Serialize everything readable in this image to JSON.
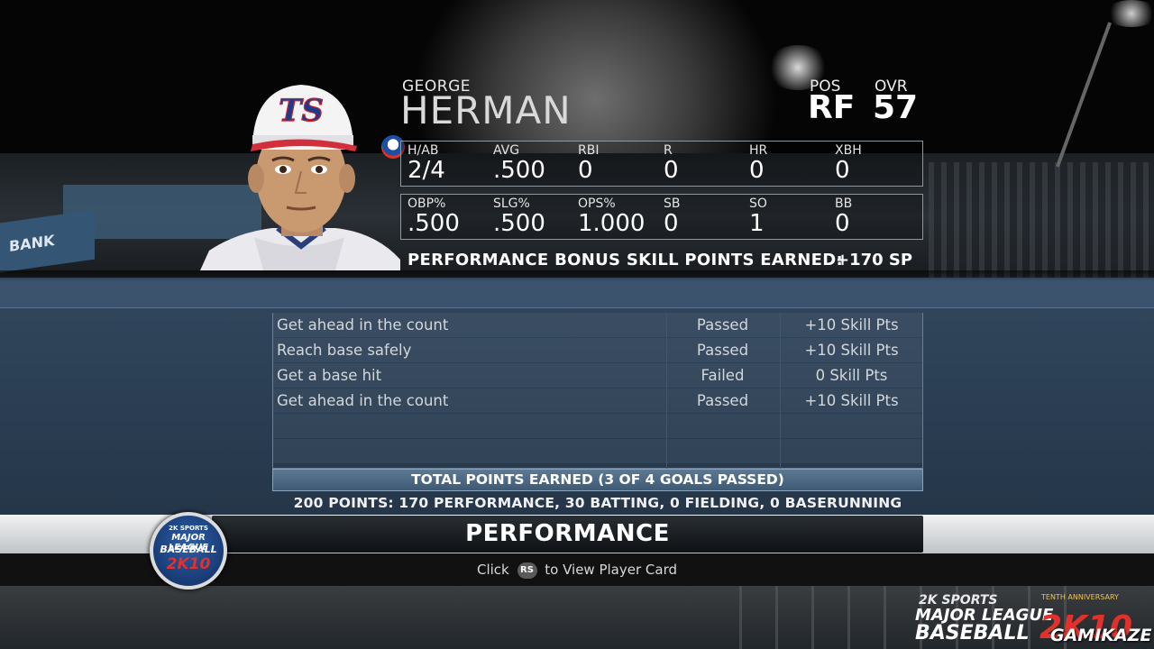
{
  "player": {
    "first_name": "GEORGE",
    "last_name": "HERMAN",
    "pos_label": "POS",
    "pos_value": "RF",
    "ovr_label": "OVR",
    "ovr_value": "57",
    "cap_logo": "TS"
  },
  "stats_row1": [
    {
      "label": "H/AB",
      "value": "2/4"
    },
    {
      "label": "AVG",
      "value": ".500"
    },
    {
      "label": "RBI",
      "value": "0"
    },
    {
      "label": "R",
      "value": "0"
    },
    {
      "label": "HR",
      "value": "0"
    },
    {
      "label": "XBH",
      "value": "0"
    }
  ],
  "stats_row2": [
    {
      "label": "OBP%",
      "value": ".500"
    },
    {
      "label": "SLG%",
      "value": ".500"
    },
    {
      "label": "OPS%",
      "value": "1.000"
    },
    {
      "label": "SB",
      "value": "0"
    },
    {
      "label": "SO",
      "value": "1"
    },
    {
      "label": "BB",
      "value": "0"
    }
  ],
  "bonus": {
    "label": "PERFORMANCE BONUS SKILL POINTS EARNED:",
    "value": "+170 SP"
  },
  "goals": [
    {
      "name": "Get ahead in the count",
      "status": "Passed",
      "points": "+10 Skill Pts"
    },
    {
      "name": "Reach base safely",
      "status": "Passed",
      "points": "+10 Skill Pts"
    },
    {
      "name": "Get a base hit",
      "status": "Failed",
      "points": "0 Skill Pts"
    },
    {
      "name": "Get ahead in the count",
      "status": "Passed",
      "points": "+10 Skill Pts"
    }
  ],
  "total": {
    "label": "TOTAL POINTS EARNED (3 OF 4 GOALS PASSED)",
    "summary": "200 POINTS: 170 PERFORMANCE, 30 BATTING, 0 FIELDING, 0 BASERUNNING"
  },
  "screen_title": "PERFORMANCE",
  "hint": {
    "prefix": "Click",
    "button": "RS",
    "suffix": "to View Player Card"
  },
  "background": {
    "ad_text": "BANK"
  },
  "logo_badge": {
    "line1": "2K SPORTS",
    "line2": "MAJOR LEAGUE",
    "line3": "BASEBALL",
    "line4": "2K10"
  },
  "watermark": {
    "line1": "2K SPORTS",
    "line2": "MAJOR LEAGUE",
    "line3": "BASEBALL",
    "line4": "2K10",
    "anniversary": "TENTH ANNIVERSARY",
    "site": "GAMIKAZE"
  },
  "colors": {
    "panel": "#2d4157",
    "total_bar": "#4d6984",
    "logo_red": "#e0312b"
  }
}
